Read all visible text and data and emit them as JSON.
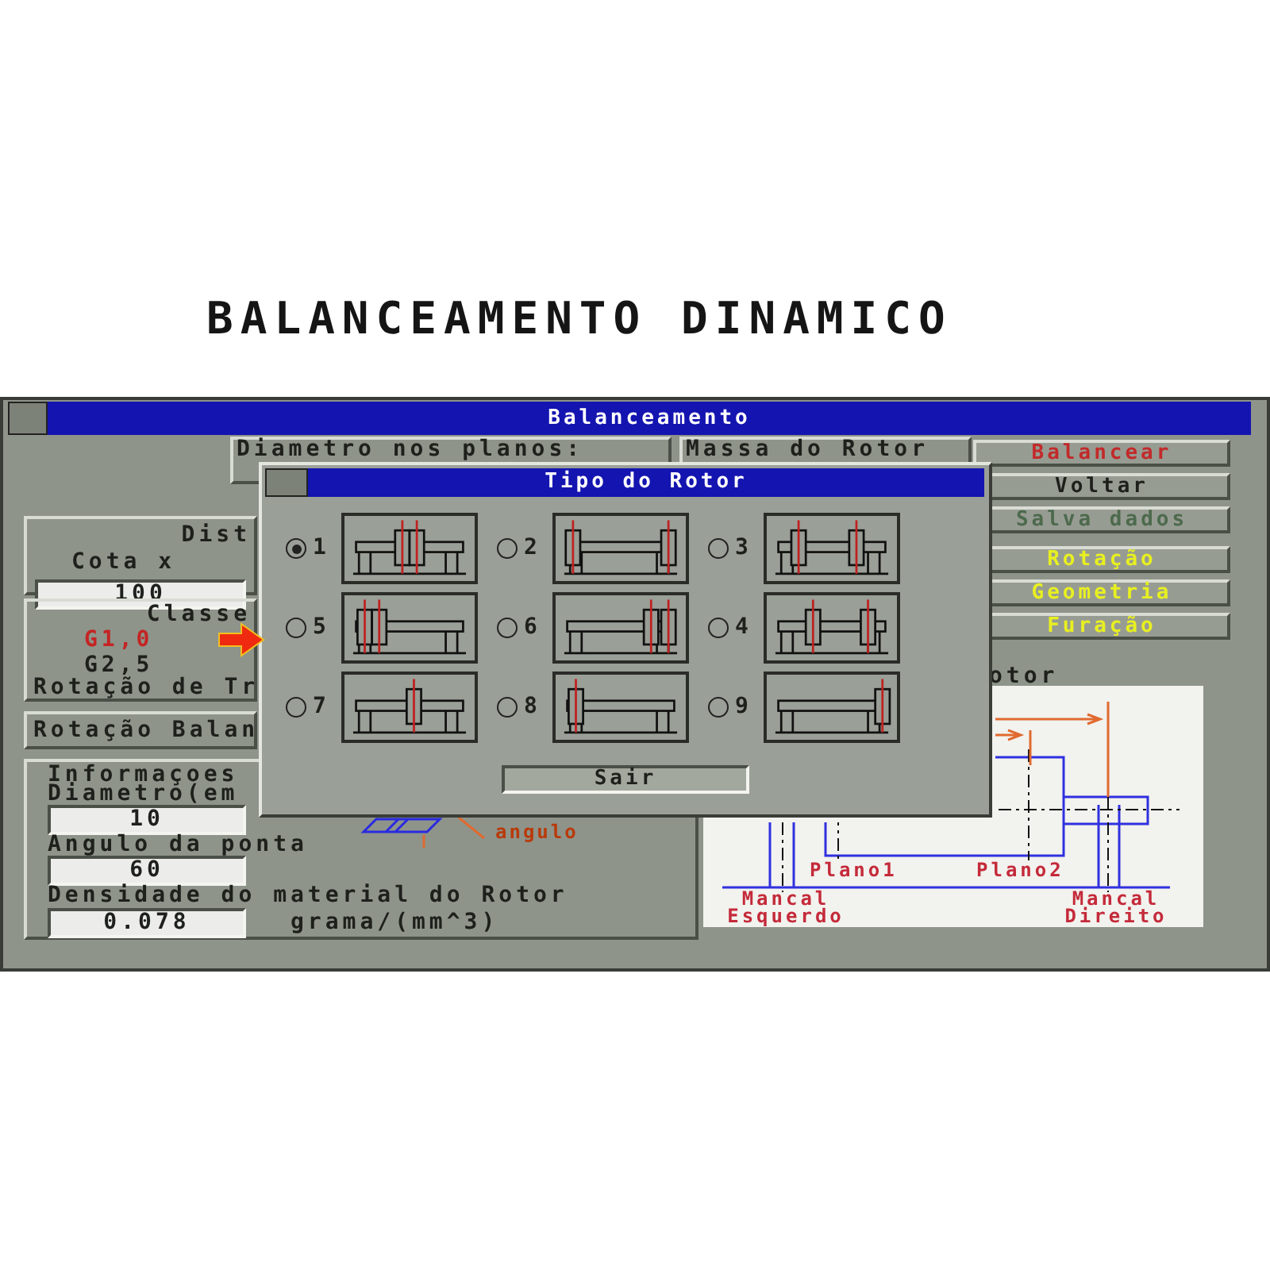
{
  "title": "BALANCEAMENTO DINAMICO",
  "window": {
    "title": "Balanceamento"
  },
  "top_boxes": [
    {
      "label": "Diametro nos planos:"
    },
    {
      "label": "Massa do Rotor"
    }
  ],
  "buttons": [
    {
      "label": "Balancear",
      "kind": "primary"
    },
    {
      "label": "Voltar",
      "kind": "normal"
    },
    {
      "label": "Salva dados",
      "kind": "disabled"
    },
    {
      "label": "Rotação",
      "kind": "view"
    },
    {
      "label": "Geometria",
      "kind": "view"
    },
    {
      "label": "Furação",
      "kind": "view"
    }
  ],
  "distance": {
    "title": "Dist",
    "label": "Cota x",
    "value": "100"
  },
  "class": {
    "title": "Classe",
    "options": [
      {
        "label": "G1,0",
        "selected": true
      },
      {
        "label": "G2,5",
        "selected": false
      }
    ],
    "note": "Rotação de Tr"
  },
  "rotation": {
    "label": "Rotação Balan"
  },
  "info": {
    "title": "Informaçoes",
    "angle_label": "angulo",
    "fields": [
      {
        "label": "Diametro(em",
        "value": "10"
      },
      {
        "label": "Angulo da ponta",
        "value": "60"
      },
      {
        "label": "Densidade do material do Rotor",
        "value": "0.078",
        "unit": "grama/(mm^3)"
      }
    ]
  },
  "diagram": {
    "title": "otor",
    "planes": [
      "Plano1",
      "Plano2"
    ],
    "bearings": [
      "Mancal Esquerdo",
      "Mancal Direito"
    ]
  },
  "dialog": {
    "title": "Tipo do Rotor",
    "button": "Sair",
    "options": [
      {
        "label": "1",
        "selected": true
      },
      {
        "label": "2",
        "selected": false
      },
      {
        "label": "3",
        "selected": false
      },
      {
        "label": "5",
        "selected": false
      },
      {
        "label": "6",
        "selected": false
      },
      {
        "label": "4",
        "selected": false
      },
      {
        "label": "7",
        "selected": false
      },
      {
        "label": "8",
        "selected": false
      },
      {
        "label": "9",
        "selected": false
      }
    ]
  }
}
